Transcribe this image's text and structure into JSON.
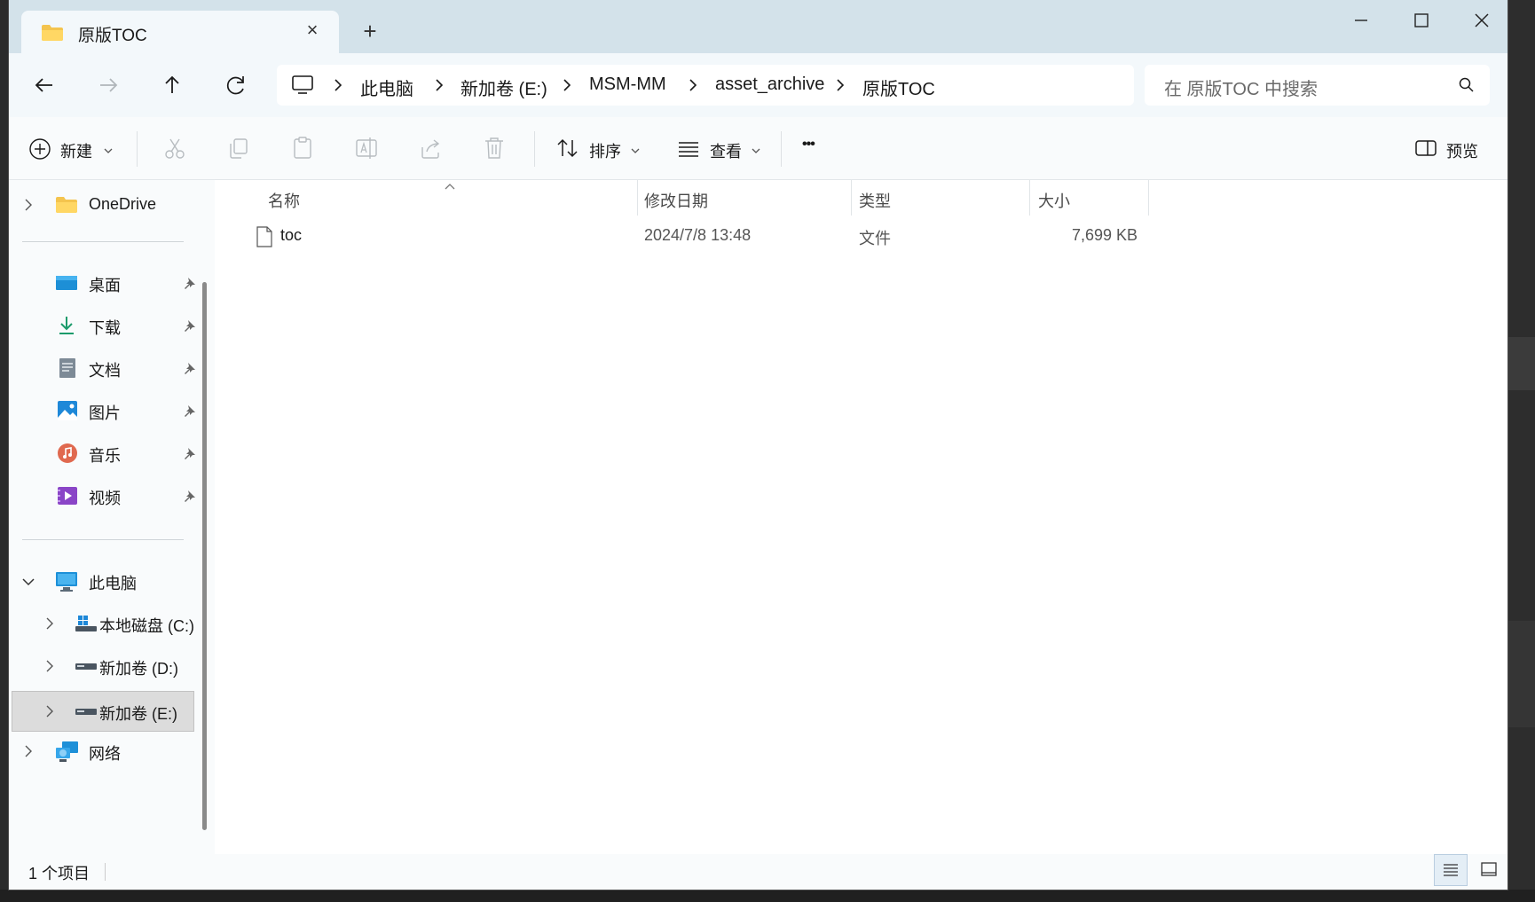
{
  "window": {
    "tab_title": "原版TOC",
    "tab_close_symbol": "×",
    "new_tab_symbol": "+"
  },
  "nav": {
    "crumbs": [
      "此电脑",
      "新加卷 (E:)",
      "MSM-MM",
      "asset_archive",
      "原版TOC"
    ],
    "search_placeholder": "在 原版TOC 中搜索"
  },
  "toolbar": {
    "new_label": "新建",
    "sort_label": "排序",
    "view_label": "查看",
    "more_label": "•••",
    "preview_label": "预览"
  },
  "sidebar": {
    "onedrive": "OneDrive",
    "quick_access": [
      {
        "label": "桌面",
        "icon": "desktop-icon"
      },
      {
        "label": "下载",
        "icon": "download-icon"
      },
      {
        "label": "文档",
        "icon": "documents-icon"
      },
      {
        "label": "图片",
        "icon": "pictures-icon"
      },
      {
        "label": "音乐",
        "icon": "music-icon"
      },
      {
        "label": "视频",
        "icon": "videos-icon"
      }
    ],
    "this_pc": "此电脑",
    "drives": [
      {
        "label": "本地磁盘 (C:)"
      },
      {
        "label": "新加卷 (D:)"
      },
      {
        "label": "新加卷 (E:)",
        "selected": true
      }
    ],
    "network": "网络"
  },
  "columns": {
    "name": "名称",
    "modified": "修改日期",
    "type": "类型",
    "size": "大小"
  },
  "files": [
    {
      "name": "toc",
      "modified": "2024/7/8 13:48",
      "type": "文件",
      "size": "7,699 KB"
    }
  ],
  "status": {
    "item_count": "1 个项目"
  },
  "colors": {
    "titlebar": "#d3e2ea",
    "selected": "#dadada",
    "accent": "#005fb8"
  }
}
